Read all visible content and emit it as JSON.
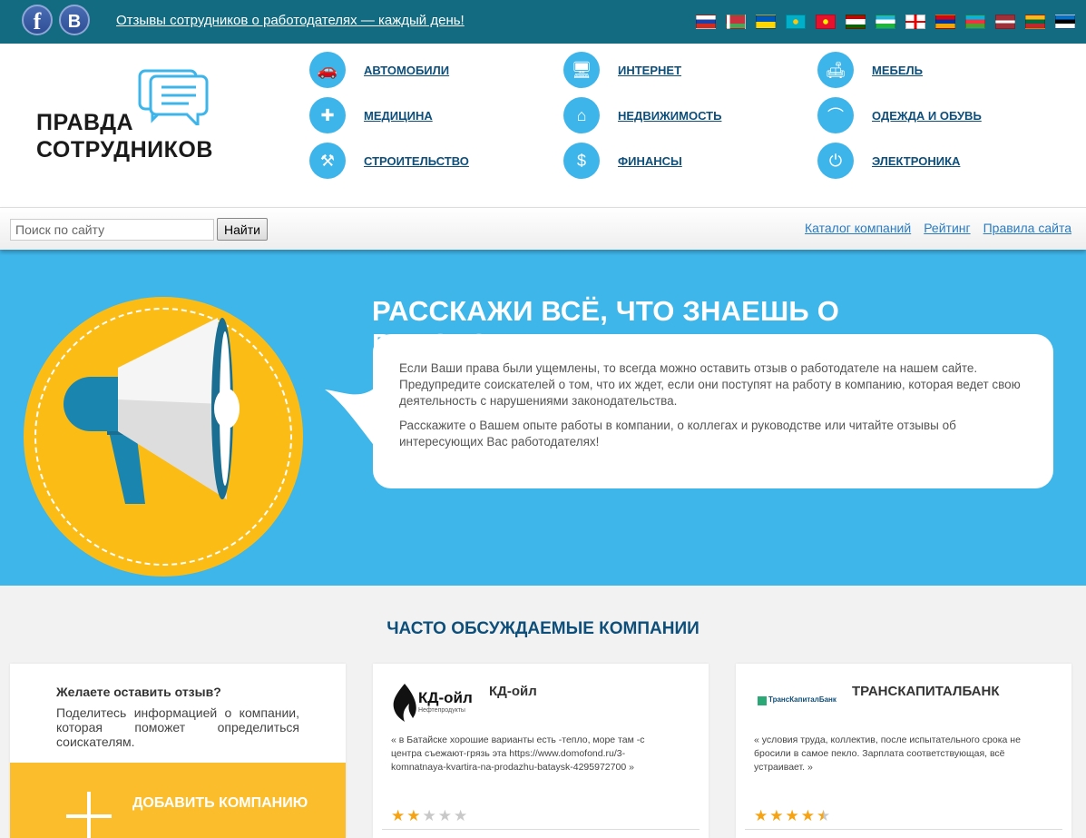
{
  "topbar": {
    "social": [
      {
        "name": "facebook",
        "glyph": "f"
      },
      {
        "name": "vkontakte",
        "glyph": "B"
      }
    ],
    "tagline": "Отзывы сотрудников о работодателях — каждый день!",
    "flags": [
      "ru",
      "by",
      "ua",
      "kz",
      "kg",
      "tj",
      "uz",
      "ge",
      "am",
      "az",
      "lv",
      "lt",
      "ee"
    ]
  },
  "logo": {
    "line1": "ПРАВДА",
    "line2": "СОТРУДНИКОВ"
  },
  "categories": [
    {
      "label": "АВТОМОБИЛИ",
      "icon": "car-icon",
      "glyph": "🚗"
    },
    {
      "label": "ИНТЕРНЕТ",
      "icon": "monitor-icon",
      "glyph": "🖥"
    },
    {
      "label": "МЕБЕЛЬ",
      "icon": "sofa-icon",
      "glyph": "🛋"
    },
    {
      "label": "МЕДИЦИНА",
      "icon": "medkit-icon",
      "glyph": "✚"
    },
    {
      "label": "НЕДВИЖИМОСТЬ",
      "icon": "house-icon",
      "glyph": "⌂"
    },
    {
      "label": "ОДЕЖДА И ОБУВЬ",
      "icon": "hanger-icon",
      "glyph": "⌒"
    },
    {
      "label": "СТРОИТЕЛЬСТВО",
      "icon": "crane-icon",
      "glyph": "⚒"
    },
    {
      "label": "ФИНАНСЫ",
      "icon": "coins-icon",
      "glyph": "$"
    },
    {
      "label": "ЭЛЕКТРОНИКА",
      "icon": "power-icon",
      "glyph": "⏻"
    }
  ],
  "search": {
    "placeholder": "Поиск по сайту",
    "button": "Найти"
  },
  "nav": [
    "Каталог компаний",
    "Рейтинг",
    "Правила сайта"
  ],
  "hero": {
    "title": "РАССКАЖИ ВСЁ, ЧТО ЗНАЕШЬ О РАБОТОДАТЕЛЕ!",
    "paragraph1": "Если Ваши права были ущемлены, то всегда можно оставить отзыв о работодателе на нашем сайте. Предупредите соискателей о том, что их ждет, если они поступят на работу в компанию, которая ведет свою деятельность с нарушениями законодательства.",
    "paragraph2": "Расскажите о Вашем опыте работы в компании, о коллегах и руководстве или читайте отзывы об интересующих Вас работодателях!"
  },
  "companies": {
    "title": "ЧАСТО ОБСУЖДАЕМЫЕ КОМПАНИИ",
    "add_card": {
      "title": "Желаете оставить отзыв?",
      "text": "Поделитесь информацией о компании, которая поможет определиться соискателям.",
      "button": "ДОБАВИТЬ КОМПАНИЮ"
    },
    "items": [
      {
        "name": "КД-ойл",
        "logo_text": "КД-ойл",
        "logo_subtext": "Нефтепродукты",
        "quote": "« в Батайске хорошие варианты есть -тепло, море там -с центра съежают-грязь эта https://www.domofond.ru/3-komnatnaya-kvartira-na-prodazhu-bataysk-4295972700 »",
        "rating": 2
      },
      {
        "name": "ТРАНСКАПИТАЛБАНК",
        "logo_text": "ТрансКапиталБанк",
        "quote": "« условия труда, коллектив, после испытательного срока не бросили в самое пекло. Зарплата соответствующая, всё устраивает. »",
        "rating": 4.5
      }
    ]
  },
  "colors": {
    "teal": "#126b80",
    "hero_blue": "#3fb6ea",
    "yellow": "#fcbc16",
    "dark_blue": "#0d4f7a"
  }
}
